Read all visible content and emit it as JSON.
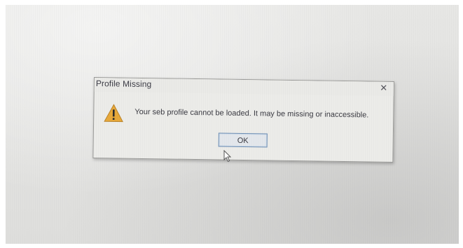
{
  "dialog": {
    "title": "Profile Missing",
    "close_glyph": "✕",
    "icon": "warning-icon",
    "message": "Your seb profile cannot be loaded. It may be missing or inaccessible.",
    "ok_label": "OK"
  },
  "colors": {
    "dialog_bg": "#ecece9",
    "button_border": "#6f8fb4",
    "warning_fill": "#e8a93a",
    "text": "#3a3a42"
  }
}
